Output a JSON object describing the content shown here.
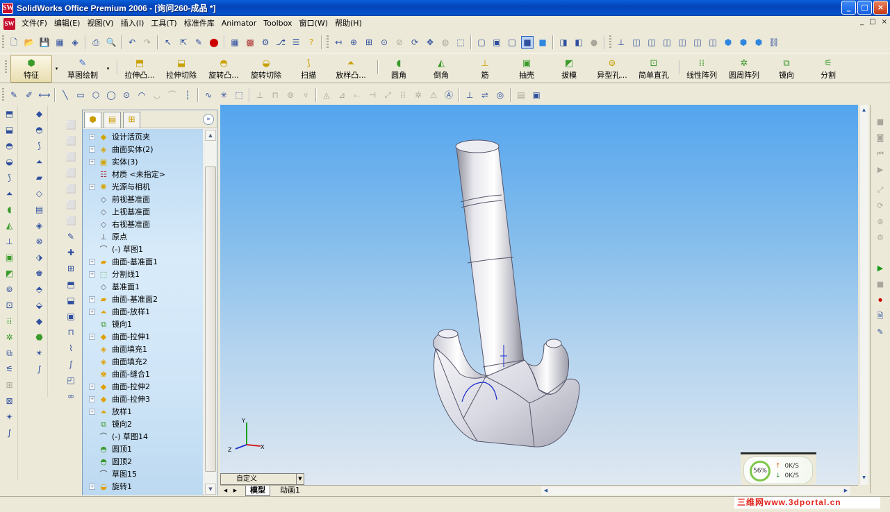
{
  "window": {
    "title": "SolidWorks Office Premium 2006 - [询问260-成品 *]",
    "logo_text": "SW",
    "min_label": "_",
    "max_label": "□",
    "close_label": "×"
  },
  "menu": {
    "items": [
      "文件(F)",
      "编辑(E)",
      "视图(V)",
      "插入(I)",
      "工具(T)",
      "标准件库",
      "Animator",
      "Toolbox",
      "窗口(W)",
      "帮助(H)"
    ],
    "doc_controls": [
      "_",
      "□",
      "×"
    ]
  },
  "commandmanager": {
    "tabs": [
      {
        "label": "特征"
      },
      {
        "label": "草图绘制"
      }
    ],
    "commands": [
      {
        "label": "拉伸凸..."
      },
      {
        "label": "拉伸切除"
      },
      {
        "label": "旋转凸..."
      },
      {
        "label": "旋转切除"
      },
      {
        "label": "扫描"
      },
      {
        "label": "放样凸..."
      },
      {
        "label": "圆角"
      },
      {
        "label": "倒角"
      },
      {
        "label": "筋"
      },
      {
        "label": "抽壳"
      },
      {
        "label": "拔模"
      },
      {
        "label": "异型孔..."
      },
      {
        "label": "简单直孔"
      },
      {
        "label": "线性阵列"
      },
      {
        "label": "圆周阵列"
      },
      {
        "label": "镜向"
      },
      {
        "label": "分割"
      }
    ]
  },
  "feature_tree": {
    "items": [
      {
        "label": "设计活页夹",
        "icon": "binder-icon",
        "expandable": true
      },
      {
        "label": "曲面实体(2)",
        "icon": "surface-bodies-icon",
        "expandable": true
      },
      {
        "label": "实体(3)",
        "icon": "solid-bodies-icon",
        "expandable": true
      },
      {
        "label": "材质 <未指定>",
        "icon": "material-icon",
        "expandable": false
      },
      {
        "label": "光源与相机",
        "icon": "lights-camera-icon",
        "expandable": true
      },
      {
        "label": "前视基准面",
        "icon": "plane-icon",
        "expandable": false
      },
      {
        "label": "上视基准面",
        "icon": "plane-icon",
        "expandable": false
      },
      {
        "label": "右视基准面",
        "icon": "plane-icon",
        "expandable": false
      },
      {
        "label": "原点",
        "icon": "origin-icon",
        "expandable": false
      },
      {
        "label": "(-) 草图1",
        "icon": "sketch-icon",
        "expandable": false
      },
      {
        "label": "曲面-基准面1",
        "icon": "planar-surface-icon",
        "expandable": true
      },
      {
        "label": "分割线1",
        "icon": "split-line-icon",
        "expandable": true
      },
      {
        "label": "基准面1",
        "icon": "plane-icon",
        "expandable": false
      },
      {
        "label": "曲面-基准面2",
        "icon": "planar-surface-icon",
        "expandable": true
      },
      {
        "label": "曲面-放样1",
        "icon": "loft-surface-icon",
        "expandable": true
      },
      {
        "label": "镜向1",
        "icon": "mirror-icon",
        "expandable": false
      },
      {
        "label": "曲面-拉伸1",
        "icon": "extrude-surface-icon",
        "expandable": true
      },
      {
        "label": "曲面填充1",
        "icon": "fill-surface-icon",
        "expandable": false
      },
      {
        "label": "曲面填充2",
        "icon": "fill-surface-icon",
        "expandable": false
      },
      {
        "label": "曲面-缝合1",
        "icon": "knit-surface-icon",
        "expandable": false
      },
      {
        "label": "曲面-拉伸2",
        "icon": "extrude-surface-icon",
        "expandable": true
      },
      {
        "label": "曲面-拉伸3",
        "icon": "extrude-surface-icon",
        "expandable": true
      },
      {
        "label": "放样1",
        "icon": "loft-icon",
        "expandable": true
      },
      {
        "label": "镜向2",
        "icon": "mirror-icon",
        "expandable": false
      },
      {
        "label": "(-) 草图14",
        "icon": "sketch-icon",
        "expandable": false
      },
      {
        "label": "圆顶1",
        "icon": "dome-icon",
        "expandable": false
      },
      {
        "label": "圆顶2",
        "icon": "dome-icon",
        "expandable": false
      },
      {
        "label": "草图15",
        "icon": "sketch-icon",
        "expandable": false
      },
      {
        "label": "旋转1",
        "icon": "revolve-icon",
        "expandable": true
      }
    ]
  },
  "viewport": {
    "view_selector": "自定义",
    "axes": {
      "x": "X",
      "y": "Y",
      "z": "Z"
    },
    "sheet_tabs": [
      "模型",
      "动画1"
    ]
  },
  "net_widget": {
    "percent": "56%",
    "up": "0K/S",
    "down": "0K/S"
  },
  "watermark": "三维网www.3dportal.cn"
}
